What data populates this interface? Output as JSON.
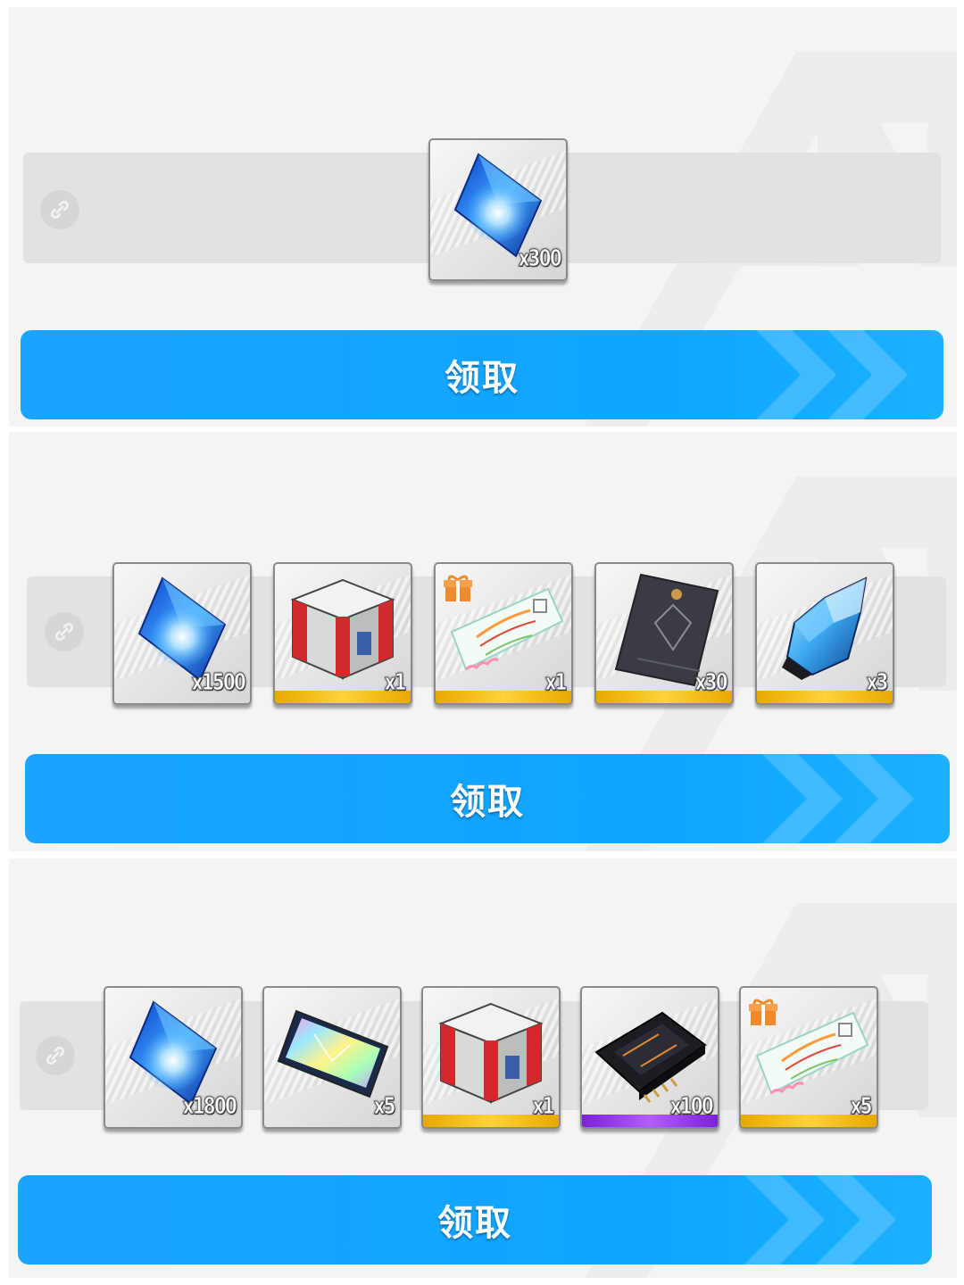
{
  "panels": [
    {
      "claim_label": "领取",
      "items": [
        {
          "name": "blue-crystal",
          "qty": "x300",
          "rarity": "none"
        }
      ]
    },
    {
      "claim_label": "领取",
      "items": [
        {
          "name": "blue-crystal",
          "qty": "x1500",
          "rarity": "none"
        },
        {
          "name": "supply-box",
          "qty": "x1",
          "rarity": "gold"
        },
        {
          "name": "gift-ticket",
          "qty": "x1",
          "rarity": "gold"
        },
        {
          "name": "dark-card",
          "qty": "x30",
          "rarity": "gold"
        },
        {
          "name": "ice-crystal",
          "qty": "x3",
          "rarity": "gold"
        }
      ]
    },
    {
      "claim_label": "领取",
      "items": [
        {
          "name": "blue-crystal",
          "qty": "x1800",
          "rarity": "none"
        },
        {
          "name": "holo-card",
          "qty": "x5",
          "rarity": "none"
        },
        {
          "name": "supply-box",
          "qty": "x1",
          "rarity": "gold"
        },
        {
          "name": "black-module",
          "qty": "x100",
          "rarity": "purple"
        },
        {
          "name": "gift-ticket",
          "qty": "x5",
          "rarity": "gold"
        }
      ]
    }
  ],
  "colors": {
    "button": "#0fa6ff",
    "gold": "#ffd23a",
    "purple": "#b45cff"
  }
}
